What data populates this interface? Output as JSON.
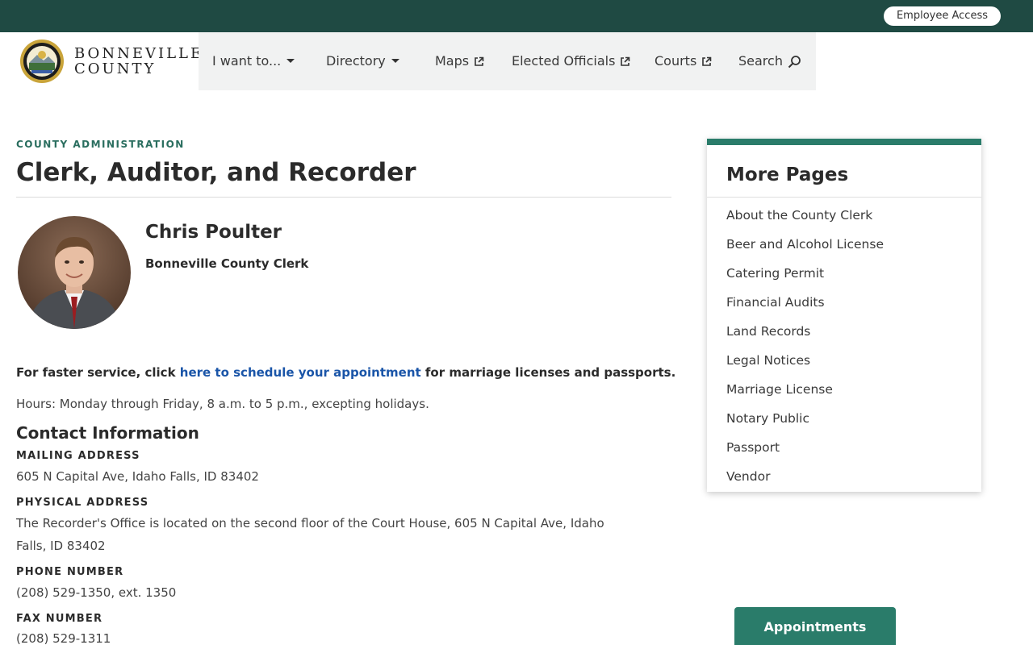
{
  "utility": {
    "employee_access": "Employee Access"
  },
  "brand": {
    "line1": "BONNEVILLE",
    "line2": "COUNTY"
  },
  "nav": {
    "items": [
      {
        "label": "I want to...",
        "icon": "caret-down-icon"
      },
      {
        "label": "Directory",
        "icon": "caret-down-icon"
      },
      {
        "label": "Maps",
        "icon": "external-link-icon"
      },
      {
        "label": "Elected Officials",
        "icon": "external-link-icon"
      },
      {
        "label": "Courts",
        "icon": "external-link-icon"
      },
      {
        "label": "Search",
        "icon": "search-icon"
      }
    ]
  },
  "page": {
    "eyebrow": "COUNTY ADMINISTRATION",
    "title": "Clerk, Auditor, and Recorder"
  },
  "official": {
    "name": "Chris Poulter",
    "role": "Bonneville County Clerk"
  },
  "notice": {
    "prefix": "For faster service, click ",
    "link": "here to schedule your appointment",
    "suffix": " for marriage licenses and passports."
  },
  "hours": "Hours:  Monday through Friday, 8 a.m. to 5 p.m., excepting holidays.",
  "contact": {
    "heading": "Contact Information",
    "mailing_label": "MAILING ADDRESS",
    "mailing_value": "605 N Capital Ave, Idaho Falls, ID  83402",
    "physical_label": "PHYSICAL ADDRESS",
    "physical_value": "The Recorder's Office is located on the second floor of the Court House, 605 N Capital Ave, Idaho Falls, ID 83402",
    "phone_label": "PHONE NUMBER",
    "phone_value": "(208) 529-1350, ext. 1350",
    "fax_label": "FAX NUMBER",
    "fax_value": "(208) 529-1311"
  },
  "sidebar": {
    "title": "More Pages",
    "items": [
      "About the County Clerk",
      "Beer and Alcohol License",
      "Catering Permit",
      "Financial Audits",
      "Land Records",
      "Legal Notices",
      "Marriage License",
      "Notary Public",
      "Passport",
      "Vendor"
    ]
  },
  "appointments_button": "Appointments",
  "colors": {
    "topbar": "#1f4a43",
    "accent": "#2a7c6a",
    "link": "#1a55a8",
    "nav_bg": "#f1f2f2"
  }
}
